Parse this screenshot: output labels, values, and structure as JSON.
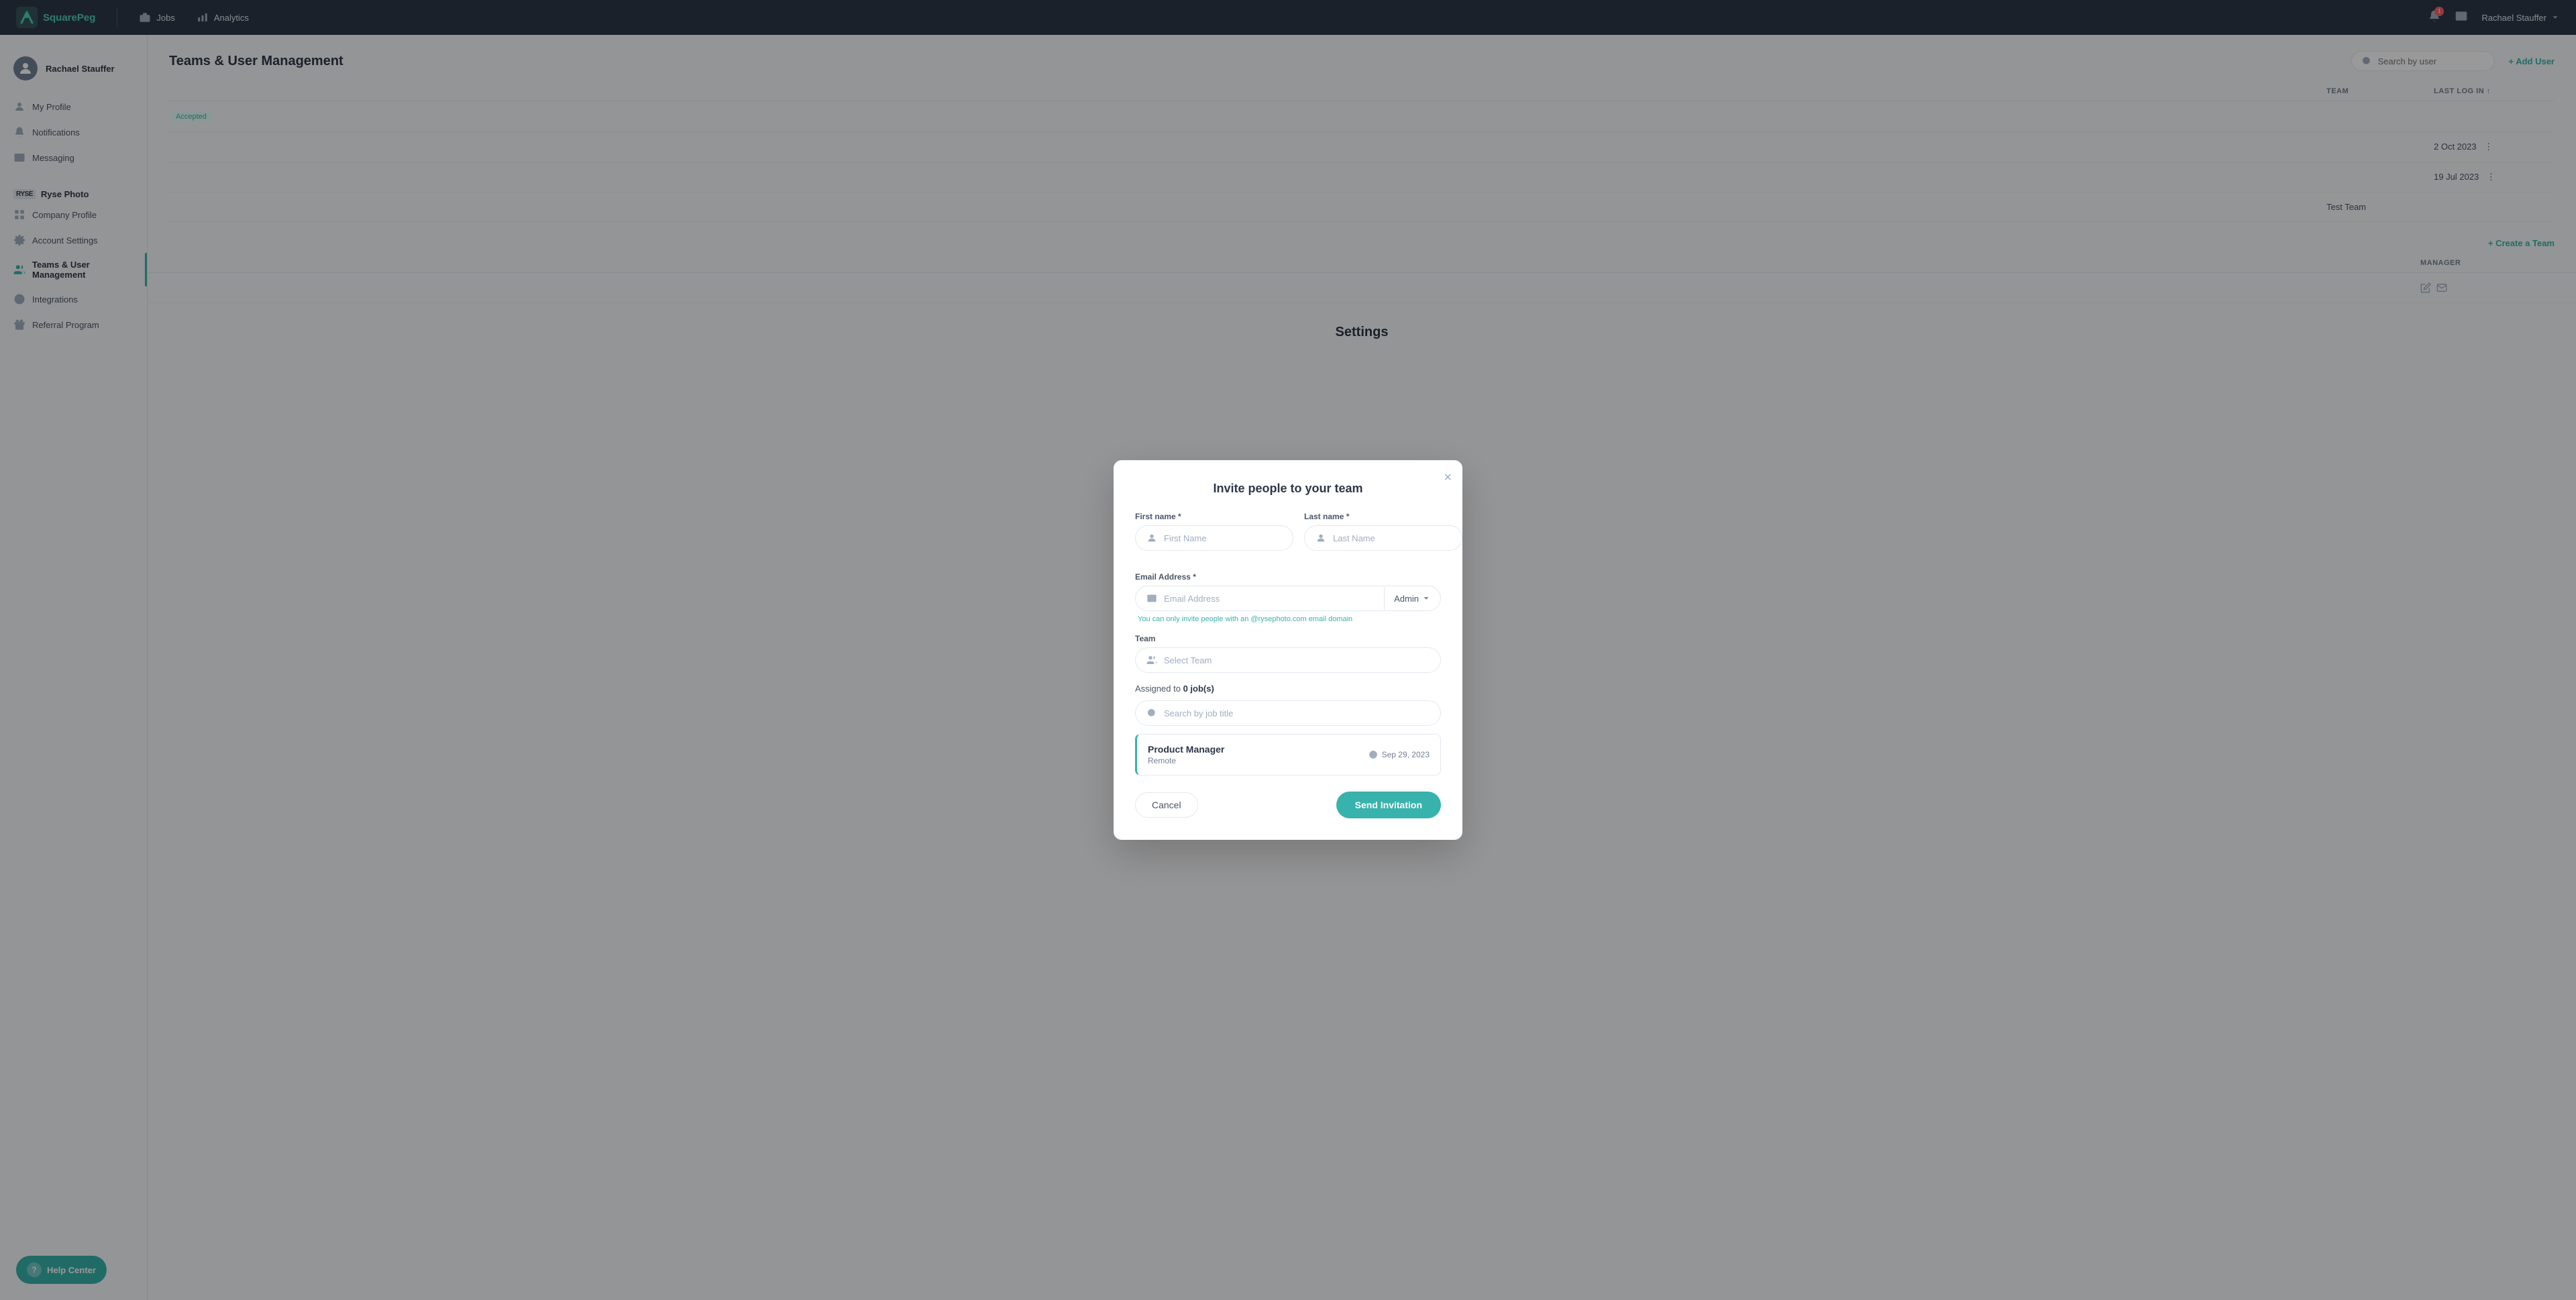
{
  "app": {
    "name": "SquarePeg",
    "logo_color": "#4fd1b5"
  },
  "topnav": {
    "items": [
      {
        "id": "jobs",
        "label": "Jobs",
        "icon": "briefcase"
      },
      {
        "id": "analytics",
        "label": "Analytics",
        "icon": "bar-chart"
      }
    ],
    "notification_count": "1",
    "user": "Rachael Stauffer"
  },
  "sidebar": {
    "user": {
      "name": "Rachael Stauffer"
    },
    "personal_items": [
      {
        "id": "my-profile",
        "label": "My Profile",
        "icon": "user"
      },
      {
        "id": "notifications",
        "label": "Notifications",
        "icon": "bell"
      },
      {
        "id": "messaging",
        "label": "Messaging",
        "icon": "mail"
      }
    ],
    "brand": {
      "logo_text": "RYSE",
      "name": "Ryse Photo"
    },
    "company_items": [
      {
        "id": "company-profile",
        "label": "Company Profile",
        "icon": "grid"
      },
      {
        "id": "account-settings",
        "label": "Account Settings",
        "icon": "gear"
      },
      {
        "id": "teams-user-management",
        "label": "Teams & User Management",
        "icon": "users",
        "active": true
      },
      {
        "id": "integrations",
        "label": "Integrations",
        "icon": "circle"
      },
      {
        "id": "referral-program",
        "label": "Referral Program",
        "icon": "gift"
      }
    ]
  },
  "main": {
    "title": "Teams & User Management",
    "search_placeholder": "Search by user",
    "add_user_label": "+ Add User",
    "table": {
      "headers": [
        "",
        "TEAM",
        "LAST LOG IN"
      ],
      "rows": [
        {
          "status": "Accepted",
          "team": "",
          "last_login": ""
        },
        {
          "status": "",
          "team": "",
          "last_login": "2 Oct 2023"
        },
        {
          "status": "",
          "team": "",
          "last_login": "19 Jul 2023"
        },
        {
          "status": "",
          "team": "Test Team",
          "last_login": ""
        }
      ]
    },
    "create_team_label": "+ Create a Team",
    "teams_table": {
      "headers": [
        "",
        "MANAGER"
      ]
    },
    "settings_title": "Settings"
  },
  "modal": {
    "title": "Invite people to your team",
    "close_label": "×",
    "first_name_label": "First name *",
    "first_name_placeholder": "First Name",
    "last_name_label": "Last name *",
    "last_name_placeholder": "Last Name",
    "email_label": "Email Address *",
    "email_placeholder": "Email Address",
    "admin_label": "Admin",
    "domain_hint": "You can only invite people with an @rysephoto.com email domain",
    "team_label": "Team",
    "team_placeholder": "Select Team",
    "assigned_label": "Assigned to",
    "assigned_count": "0",
    "assigned_suffix": "job(s)",
    "job_search_placeholder": "Search by job title",
    "jobs": [
      {
        "title": "Product Manager",
        "location": "Remote",
        "date": "Sep 29, 2023"
      }
    ],
    "cancel_label": "Cancel",
    "send_label": "Send Invitation"
  },
  "help_center": {
    "label": "Help Center",
    "icon": "?"
  }
}
